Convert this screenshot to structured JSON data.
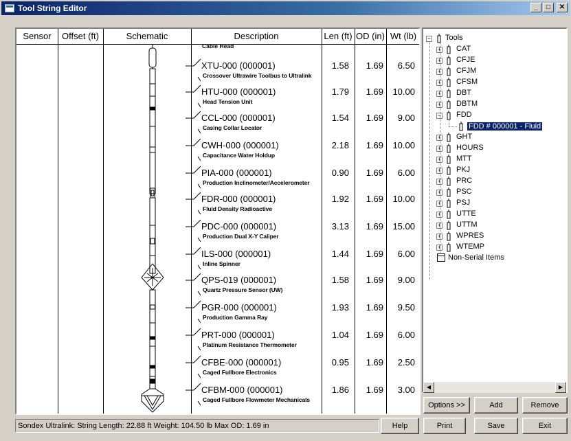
{
  "window": {
    "title": "Tool String Editor"
  },
  "columns": {
    "sensor": "Sensor",
    "offset": "Offset (ft)",
    "schematic": "Schematic",
    "description": "Description",
    "len": "Len (ft)",
    "od": "OD (in)",
    "wt": "Wt (lb)"
  },
  "first_partial_desc": "Cable Head",
  "tools": [
    {
      "name": "XTU-000 (000001)",
      "desc": "Crossover Ultrawire Toolbus to Ultralink",
      "len": "1.58",
      "od": "1.69",
      "wt": "6.50"
    },
    {
      "name": "HTU-000 (000001)",
      "desc": "Head Tension Unit",
      "len": "1.79",
      "od": "1.69",
      "wt": "10.00"
    },
    {
      "name": "CCL-000 (000001)",
      "desc": "Casing Collar Locator",
      "len": "1.54",
      "od": "1.69",
      "wt": "9.00"
    },
    {
      "name": "CWH-000 (000001)",
      "desc": "Capacitance Water Holdup",
      "len": "2.18",
      "od": "1.69",
      "wt": "10.00"
    },
    {
      "name": "PIA-000 (000001)",
      "desc": "Production Inclinometer/Accelerometer",
      "len": "0.90",
      "od": "1.69",
      "wt": "6.00"
    },
    {
      "name": "FDR-000 (000001)",
      "desc": "Fluid Density Radioactive",
      "len": "1.92",
      "od": "1.69",
      "wt": "10.00"
    },
    {
      "name": "PDC-000 (000001)",
      "desc": "Production Dual X-Y Caliper",
      "len": "3.13",
      "od": "1.69",
      "wt": "15.00"
    },
    {
      "name": "ILS-000 (000001)",
      "desc": "Inline Spinner",
      "len": "1.44",
      "od": "1.69",
      "wt": "6.00"
    },
    {
      "name": "QPS-019 (000001)",
      "desc": "Quartz Pressure Sensor (UW)",
      "len": "1.58",
      "od": "1.69",
      "wt": "9.00"
    },
    {
      "name": "PGR-000 (000001)",
      "desc": "Production Gamma Ray",
      "len": "1.93",
      "od": "1.69",
      "wt": "9.50"
    },
    {
      "name": "PRT-000 (000001)",
      "desc": "Platinum Resistance Thermometer",
      "len": "1.04",
      "od": "1.69",
      "wt": "6.00"
    },
    {
      "name": "CFBE-000 (000001)",
      "desc": "Caged Fullbore Electronics",
      "len": "0.95",
      "od": "1.69",
      "wt": "2.50"
    },
    {
      "name": "CFBM-000 (000001)",
      "desc": "Caged Fullbore Flowmeter Mechanicals",
      "len": "1.86",
      "od": "1.69",
      "wt": "3.00"
    }
  ],
  "tree": {
    "root": "Tools",
    "items": [
      "CAT",
      "CFJE",
      "CFJM",
      "CFSM",
      "DBT",
      "DBTM",
      "FDD",
      "GHT",
      "HOURS",
      "MTT",
      "PKJ",
      "PRC",
      "PSC",
      "PSJ",
      "UTTE",
      "UTTM",
      "WPRES",
      "WTEMP"
    ],
    "expanded": "FDD",
    "selected_child": "FDD  # 000001 - Fluid",
    "non_serial": "Non-Serial Items"
  },
  "buttons": {
    "options": "Options >>",
    "add": "Add",
    "remove": "Remove",
    "help": "Help",
    "print": "Print",
    "save": "Save",
    "exit": "Exit"
  },
  "status": {
    "text": "Sondex Ultralink:  String Length: 22.88 ft   Weight: 104.50 lb   Max OD: 1.69 in"
  }
}
